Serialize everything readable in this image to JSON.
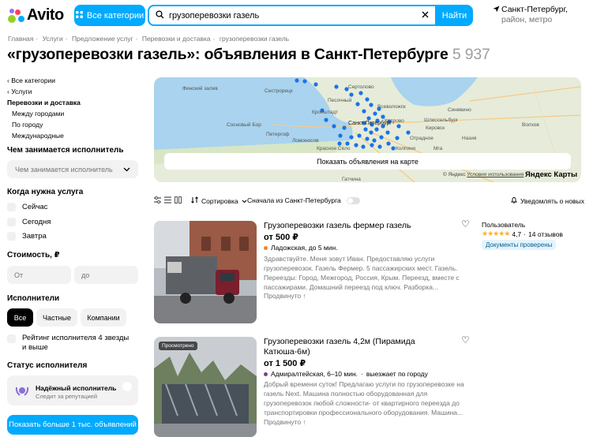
{
  "header": {
    "logo": "Avito",
    "categories_label": "Все категории",
    "search_value": "грузоперевозки газель",
    "search_button": "Найти",
    "location_city": "Санкт-Петербург,",
    "location_sub": "район, метро"
  },
  "breadcrumbs": [
    "Главная",
    "Услуги",
    "Предложение услуг",
    "Перевозки и доставка",
    "грузоперевозки газель"
  ],
  "title": "«грузоперевозки газель»: объявления в Санкт-Петербурге",
  "result_count": "5 937",
  "sidebar": {
    "back_all": "Все категории",
    "back_services": "Услуги",
    "current": "Перевозки и доставка",
    "subs": [
      "Между городами",
      "По городу",
      "Международные"
    ],
    "executor_heading": "Чем занимается исполнитель",
    "executor_placeholder": "Чем занимается исполнитель",
    "when_heading": "Когда нужна услуга",
    "when_options": [
      "Сейчас",
      "Сегодня",
      "Завтра"
    ],
    "cost_heading": "Стоимость, ₽",
    "cost_from": "От",
    "cost_to": "до",
    "executors_heading": "Исполнители",
    "executors_options": [
      "Все",
      "Частные",
      "Компании"
    ],
    "rating_label": "Рейтинг исполнителя 4 звезды и выше",
    "status_heading": "Статус исполнителя",
    "trust_title": "Надёжный исполнитель",
    "trust_sub": "Следит за репутацией",
    "show_more": "Показать больше 1 тыс. объявлений"
  },
  "map": {
    "show_button": "Показать объявления на карте",
    "places": [
      "Финский залив",
      "Сестрорецк",
      "Песочный",
      "Всеволожск",
      "Кировск",
      "Шлиссельбург",
      "Сертолово",
      "Петергоф",
      "Красное Село",
      "Колпино",
      "Гатчина",
      "Мга",
      "Волхов",
      "Назия",
      "Кронштадт",
      "Кудрово",
      "Санкт-Петербург",
      "Ломоносов",
      "Сосновый Бор",
      "Синявино",
      "Отрадное"
    ],
    "copyright": "© Яндекс",
    "terms": "Условия использования",
    "brand": "Яндекс Карты"
  },
  "toolbar": {
    "sort": "Сортировка",
    "first_from": "Сначала из Санкт-Петербурга",
    "notify": "Уведомлять о новых"
  },
  "listings": [
    {
      "title": "Грузоперевозки газель фермер газель",
      "price": "от 500 ₽",
      "metro": "Ладожская, до 5 мин.",
      "metro_color": "#f58220",
      "description": "Здравствуйте. Меня зовут Иван. Предоставляю услуги грузоперевозок. Газель Фермер. 5 пассажирских мест. Газель. Переезды: Город, Межгород, Россия, Крым. Переезд, вместе с пассажирами. Домашний переезд под ключ. Разборка...",
      "promoted": "Продвинуто",
      "seller_type": "Пользователь",
      "rating": "4,7",
      "reviews": "14 отзывов",
      "verified": "Документы проверены"
    },
    {
      "title": "Грузоперевозки газель 4,2м (Пирамида Катюша-6м)",
      "price": "от 1 500 ₽",
      "metro": "Адмиралтейская, 6–10 мин.",
      "metro_extra": "выезжает по городу",
      "metro_color": "#7c3f8e",
      "viewed": "Просмотрено",
      "description": "Добрый времени суток! Предлагаю услуги по грузоперевозке на газель Next. Машина полностью оборудованная для грузоперевозок любой сложности- от квартирного переезда до транспортировки профессионального оборудования. Машина...",
      "promoted": "Продвинуто"
    }
  ]
}
